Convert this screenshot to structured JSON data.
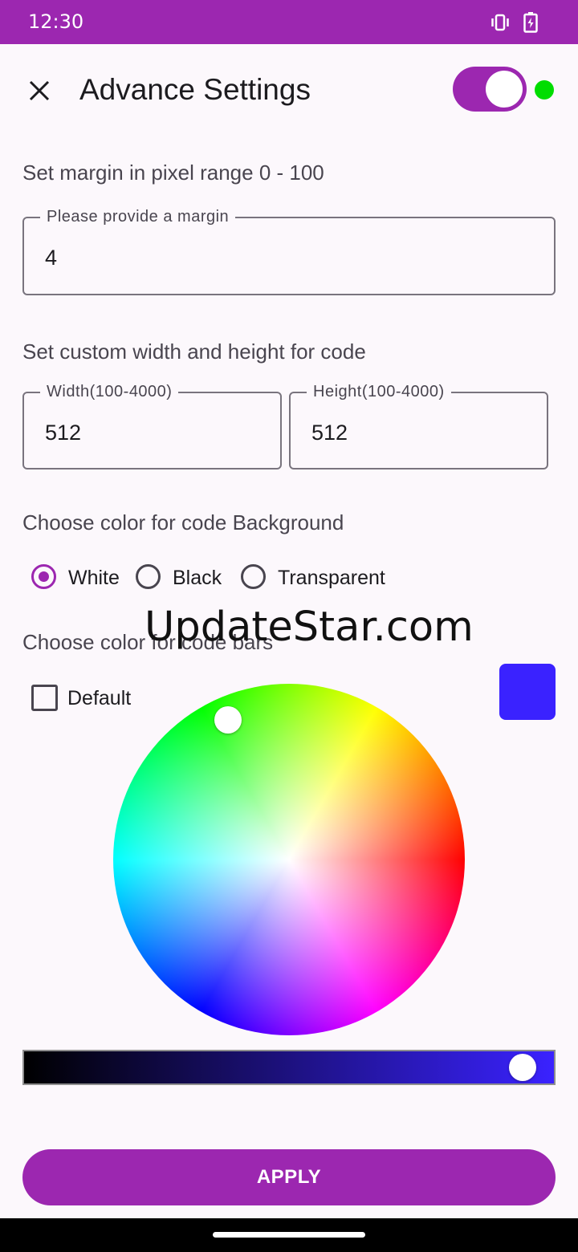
{
  "status_bar": {
    "time": "12:30",
    "icons": [
      "vibrate-icon",
      "battery-charging-icon"
    ]
  },
  "header": {
    "close_icon": "close-icon",
    "title": "Advance Settings",
    "toggle_on": true,
    "indicator_color": "#00dd00"
  },
  "margin_section": {
    "label": "Set margin in pixel range 0 - 100",
    "field": {
      "label": "Please provide a margin",
      "value": "4"
    }
  },
  "size_section": {
    "label": "Set custom width and height for code",
    "width_field": {
      "label": "Width(100-4000)",
      "value": "512"
    },
    "height_field": {
      "label": "Height(100-4000)",
      "value": "512"
    }
  },
  "background_section": {
    "label": "Choose color for code Background",
    "options": [
      {
        "label": "White",
        "selected": true
      },
      {
        "label": "Black",
        "selected": false
      },
      {
        "label": "Transparent",
        "selected": false
      }
    ]
  },
  "watermark": "UpdateStar.com",
  "bars_section": {
    "label": "Choose color for code bars",
    "default_checkbox": {
      "label": "Default",
      "checked": false
    },
    "selected_color": "#3a22ff",
    "brightness": 0.97
  },
  "apply_label": "APPLY",
  "colors": {
    "accent": "#9c27b0"
  }
}
